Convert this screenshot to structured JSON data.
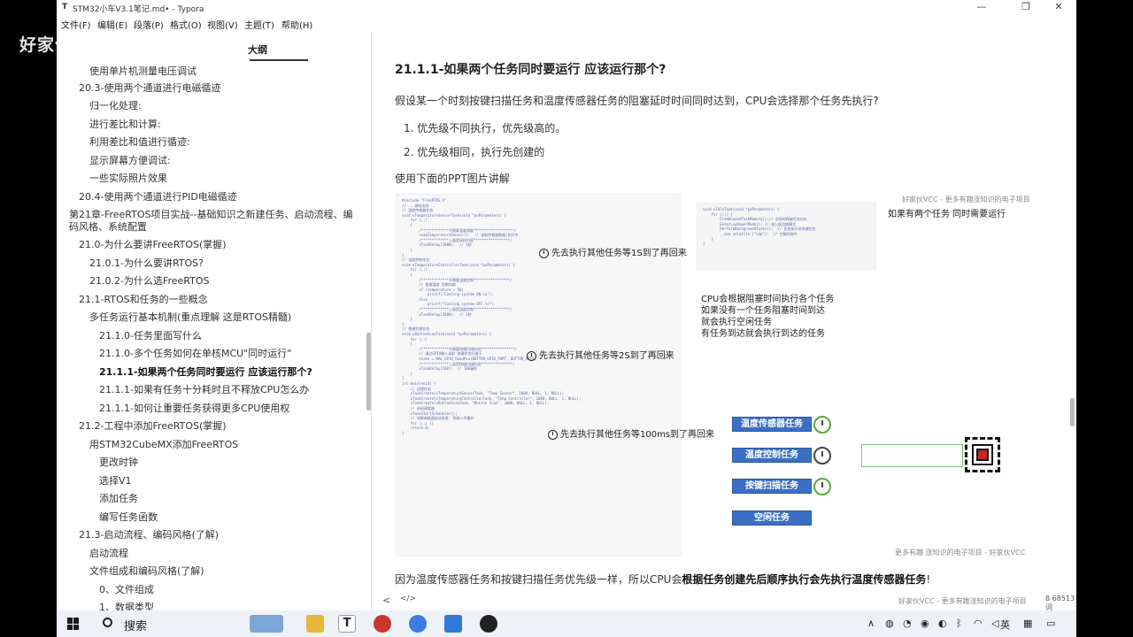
{
  "window": {
    "app_icon": "T",
    "title": "STM32小车V3.1笔记.md• - Typora",
    "controls": [
      "—",
      "❐",
      "✕"
    ]
  },
  "menu": [
    "文件(F)",
    "编辑(E)",
    "段落(P)",
    "格式(O)",
    "视图(V)",
    "主题(T)",
    "帮助(H)"
  ],
  "overlay_logo": "好家伙VCC",
  "sidebar": {
    "tab_outline": "大纲",
    "items": [
      "使用单片机测量电压调试",
      "20.3-使用两个通道进行电磁循迹",
      "归一化处理:",
      "进行差比和计算:",
      "利用差比和值进行循迹:",
      "显示屏幕方便调试:",
      "一些实际照片效果",
      "20.4-使用两个通道进行PID电磁循迹",
      "第21章-FreeRTOS项目实战--基础知识之新建任务、启动流程、编码风格、系统配置",
      "21.0-为什么要讲FreeRTOS(掌握)",
      "21.0.1-为什么要讲RTOS?",
      "21.0.2-为什么选FreeRTOS",
      "21.1-RTOS和任务的一些概念",
      "多任务运行基本机制(重点理解 这是RTOS精髓)",
      "21.1.0-任务里面写什么",
      "21.1.0-多个任务如何在单核MCU\"同时运行\"",
      "21.1.1-如果两个任务同时要运行 应该运行那个?",
      "21.1.1-如果有任务十分耗时且不释放CPU怎么办",
      "21.1.1-如何让重要任务获得更多CPU使用权",
      "21.2-工程中添加FreeRTOS(掌握)",
      "用STM32CubeMX添加FreeRTOS",
      "更改时钟",
      "选择V1",
      "添加任务",
      "编写任务函数",
      "21.3-启动流程、编码风格(了解)",
      "启动流程",
      "文件组成和编码风格(了解)",
      "0、文件组成",
      "1、数据类型"
    ]
  },
  "editor": {
    "heading": "21.1.1-如果两个任务同时要运行 应该运行那个?",
    "question": "假设某一个时刻按键扫描任务和温度传感器任务的阻塞延时时间同时达到，CPU会选择那个任务先执行?",
    "list": [
      "优先级不同执行，优先级高的。",
      "优先级相同，执行先创建的"
    ],
    "ppt_intro": "使用下面的PPT图片讲解",
    "conclusion_prefix": "因为温度传感器任务和按键扫描任务优先级一样，所以CPU会",
    "conclusion_bold": "根据任务创建先后顺序执行会先执行温度传感器任务",
    "conclusion_suffix": "!"
  },
  "slide": {
    "note1": "先去执行其他任务等1S到了再回来",
    "note2": "先去执行其他任务等2S到了再回来",
    "note3": "先去执行其他任务等100ms到了再回来",
    "watermark_top": "好家伙VCC - 更多有趣涨知识的电子项目",
    "title_right": "如果有两个任务 同时需要运行",
    "cpu_lines": [
      "CPU会根据阻塞时间执行各个任务",
      "如果没有一个任务阻塞时间到达",
      "就会执行空闲任务",
      "有任务到达就会执行到达的任务"
    ],
    "tasks": [
      "温度传感器任务",
      "温度控制任务",
      "按键扫描任务",
      "空闲任务"
    ],
    "watermark_bottom": "更多有趣 涨知识的电子项目 - 好家伙VCC",
    "code_left": [
      "#include \"FreeRTOS.h\"",
      "// ...源码出处...",
      "// 温度传感器任务",
      "void vTemperatureSensorTask(void *pvParameters) {",
      "    for (;;)",
      "    {",
      "        /*************不需要温度测量*******************/",
      "        readTemperatureSensor();  // 读取传感器数据/执行中",
      "        /*************上面是采样内容*****************/",
      "        vTaskDelay(1000);  // 1秒",
      "    }",
      "}",
      "",
      "// 温度控制任务",
      "void vTemperatureControllerTask(void *pvParameters) {",
      "    for (;;)",
      "    {",
      "        /*************不需要温度控制*****************/",
      "        // 根据温度 控制风扇",
      "        if (temperature > 50)",
      "            printf(\"Cooling system ON.\\n\");",
      "        else",
      "            printf(\"Cooling system OFF.\\n\");",
      "        /*************上面是温度控制*****************/",
      "",
      "        vTaskDelay(2000);  // 2秒",
      "    }",
      "}",
      "",
      "// 按键扫描任务",
      "void vButtonScanTask(void *pvParameters) {",
      "    for (;;)",
      "    {",
      "        /*************不需要按键扫描检测****************/",
      "        // 通过GPIO输入读取 按键状态扫描下",
      "        state = HAL_GPIO_ReadPin(BUTTON_GPIO_PORT, BUTTON_GPIO);",
      "        /*************上面是按键扫描检测***************/",
      "        vTaskDelay(100);  // 100毫秒",
      "    }",
      "}",
      "",
      "int main(void) {",
      "    // 创建任务",
      "    xTaskCreate(vTemperatureSensorTask, \"Temp Sensor\", 1000, NULL, 1, NULL);",
      "    xTaskCreate(vTemperatureControllerTask, \"Temp Controller\", 1000, NULL, 1, NULL);",
      "    xTaskCreate(vButtonScanTask, \"Button Scan\", 1000, NULL, 1, NULL);",
      "",
      "    // 启动调度器",
      "    vTaskStartScheduler();",
      "",
      "    // 如果调度器启动失败  则进入死循环",
      "    for (;;) {}",
      "    return 0;",
      "}"
    ],
    "code_right": [
      "void vIdleTask(void *pvParameters) {",
      "    for (;;) {",
      "        FreeUnusedTaskMemory();// 空闲时释放任务内存",
      "        EnterLowPowerMode(); // 进入低功耗模式",
      "        PerformBackgroundTasks();  // 后台执行非关键任务",
      "        __asm volatile (\"nop\");  // 空操作指令",
      "    }",
      "}"
    ]
  },
  "status": {
    "back": "<",
    "code_toggle": "</>",
    "watermark": "好家伙VCC - 更多有趣涨知识的电子项目",
    "word_count": "8 68513 词"
  },
  "taskbar": {
    "search_label": "搜索",
    "ime": "英"
  }
}
